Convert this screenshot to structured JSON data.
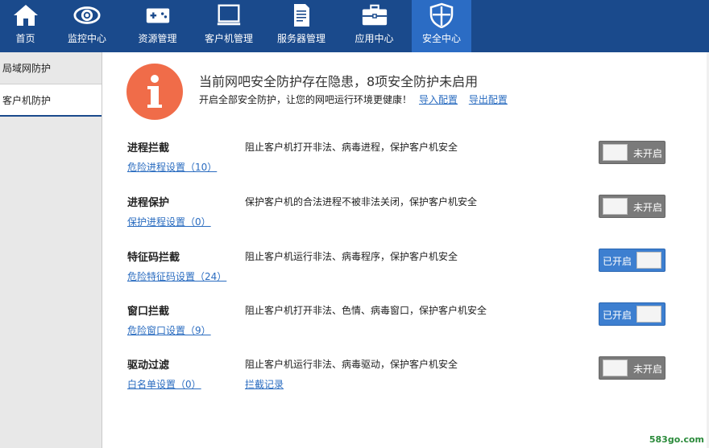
{
  "nav": {
    "items": [
      {
        "label": "首页",
        "icon": "home-icon"
      },
      {
        "label": "监控中心",
        "icon": "eye-icon"
      },
      {
        "label": "资源管理",
        "icon": "gamepad-icon"
      },
      {
        "label": "客户机管理",
        "icon": "monitor-icon"
      },
      {
        "label": "服务器管理",
        "icon": "server-icon"
      },
      {
        "label": "应用中心",
        "icon": "toolbox-icon"
      },
      {
        "label": "安全中心",
        "icon": "shield-icon"
      }
    ],
    "active_index": 6
  },
  "sidebar": {
    "items": [
      {
        "label": "局域网防护"
      },
      {
        "label": "客户机防护"
      }
    ],
    "active_index": 1
  },
  "warning": {
    "title": "当前网吧安全防护存在隐患，8项安全防护未启用",
    "subtitle": "开启全部安全防护，让您的网吧运行环境更健康！",
    "import_label": "导入配置",
    "export_label": "导出配置"
  },
  "protections": [
    {
      "name": "进程拦截",
      "link": "危险进程设置（10）",
      "desc": "阻止客户机打开非法、病毒进程，保护客户机安全",
      "state": "未开启",
      "enabled": false
    },
    {
      "name": "进程保护",
      "link": "保护进程设置（0）",
      "desc": "保护客户机的合法进程不被非法关闭，保护客户机安全",
      "state": "未开启",
      "enabled": false
    },
    {
      "name": "特征码拦截",
      "link": "危险特征码设置（24）",
      "desc": "阻止客户机运行非法、病毒程序，保护客户机安全",
      "state": "已开启",
      "enabled": true
    },
    {
      "name": "窗口拦截",
      "link": "危险窗口设置（9）",
      "desc": "阻止客户机打开非法、色情、病毒窗口，保护客户机安全",
      "state": "已开启",
      "enabled": true
    },
    {
      "name": "驱动过滤",
      "link": "白名单设置（0）",
      "desc": "阻止客户机运行非法、病毒驱动，保护客户机安全",
      "state": "未开启",
      "enabled": false,
      "extra_link": "拦截记录"
    }
  ],
  "colors": {
    "topbar": "#1a4a8c",
    "active_nav": "#2b6cc4",
    "warning": "#f06c49",
    "toggle_on": "#3d7fd0",
    "toggle_off": "#7a7a7a",
    "link": "#2a6cc0"
  },
  "watermark": "583go.com"
}
